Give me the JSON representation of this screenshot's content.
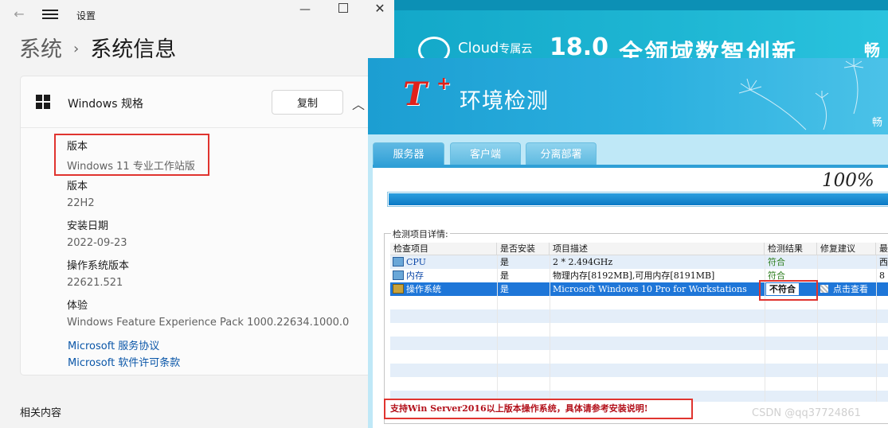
{
  "settings": {
    "window_title": "设置",
    "breadcrumb_parent": "系统",
    "breadcrumb_sep": "›",
    "breadcrumb_current": "系统信息",
    "card_title": "Windows 规格",
    "copy_label": "复制",
    "specs": [
      {
        "label": "版本",
        "value": "Windows 11 专业工作站版"
      },
      {
        "label": "版本",
        "value": "22H2"
      },
      {
        "label": "安装日期",
        "value": "2022-09-23"
      },
      {
        "label": "操作系统版本",
        "value": "22621.521"
      },
      {
        "label": "体验",
        "value": "Windows Feature Experience Pack 1000.22634.1000.0"
      }
    ],
    "links": [
      "Microsoft 服务协议",
      "Microsoft 软件许可条款"
    ],
    "related": "相关内容"
  },
  "banner": {
    "brand": "Cloud",
    "brand_suffix": "专属云",
    "version": "18.0",
    "slogan": "全领域数智创新",
    "cut_char": "畅"
  },
  "tplus": {
    "logo": "T",
    "logo_plus": "+",
    "title": "环境检测",
    "side_char": "畅",
    "tabs": [
      "服务器",
      "客户端",
      "分离部署"
    ],
    "active_tab": 0,
    "progress_text": "100%",
    "progress_value": 1.0,
    "group_label": "检测项目详情:",
    "columns": [
      "检查项目",
      "是否安装",
      "项目描述",
      "检测结果",
      "修复建议",
      "最"
    ],
    "rows": [
      {
        "name": "CPU",
        "installed": "是",
        "desc": "2 * 2.494GHz",
        "result": "符合",
        "fix": "",
        "extra": "西"
      },
      {
        "name": "内存",
        "installed": "是",
        "desc": "物理内存[8192MB],可用内存[8191MB]",
        "result": "符合",
        "fix": "",
        "extra": "8"
      },
      {
        "name": "操作系统",
        "installed": "是",
        "desc": "Microsoft Windows 10 Pro for Workstations",
        "result": "不符合",
        "fix": "点击查看",
        "extra": ""
      }
    ],
    "note": "支持Win Server2016以上版本操作系统，具体请参考安装说明!"
  },
  "watermark": "CSDN @qq37724861",
  "colors": {
    "highlight_red": "#e0342f",
    "selected_row": "#1e76d8",
    "ok_green": "#2d7d1e"
  },
  "icons": [
    "back-arrow-icon",
    "hamburger-menu-icon",
    "minimize-icon",
    "maximize-icon",
    "close-icon",
    "windows-logo-icon",
    "chevron-up-icon",
    "cloud-logo-icon",
    "computer-icon",
    "fix-icon"
  ]
}
